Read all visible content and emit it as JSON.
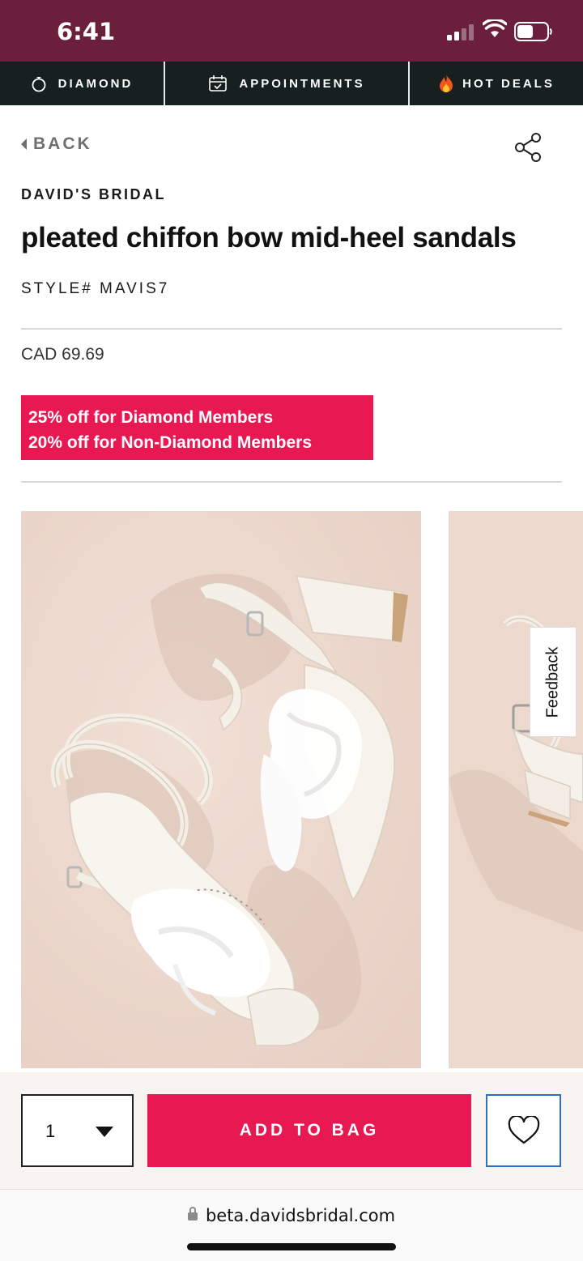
{
  "status_bar": {
    "time": "6:41"
  },
  "promo_nav": [
    {
      "label": "DIAMOND",
      "icon": "diamond-ring-icon"
    },
    {
      "label": "APPOINTMENTS",
      "icon": "calendar-check-icon"
    },
    {
      "label": "HOT DEALS",
      "icon": "fire-icon"
    }
  ],
  "nav": {
    "back_label": "BACK",
    "share_icon": "share-icon"
  },
  "product": {
    "brand": "DAVID'S BRIDAL",
    "title": "pleated chiffon bow mid-heel sandals",
    "style_number": "STYLE# MAVIS7",
    "price": "CAD 69.69",
    "discount_lines": [
      "25% off for Diamond Members",
      "20% off for Non-Diamond Members"
    ]
  },
  "gallery": {
    "images": [
      "white sandals with chiffon bow",
      "sandal side view"
    ]
  },
  "feedback_label": "Feedback",
  "purchase": {
    "quantity": "1",
    "add_to_bag_label": "ADD TO BAG",
    "wishlist_icon": "heart-icon"
  },
  "browser": {
    "url": "beta.davidsbridal.com"
  },
  "colors": {
    "status_bar": "#6b1f3a",
    "nav_bar": "#15201f",
    "accent": "#e81852",
    "image_bg": "#ecd8cd"
  }
}
